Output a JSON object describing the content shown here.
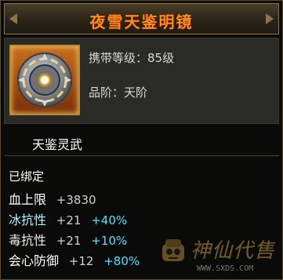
{
  "item": {
    "title": "夜雪天鉴明镜",
    "level_line": "携带等级：85级",
    "grade_line": "品阶：天阶",
    "name": "天鉴灵武",
    "bound": "已绑定",
    "icon": "mirror-icon"
  },
  "stats": [
    {
      "label": "血上限",
      "value": "+3830",
      "percent": ""
    },
    {
      "label": "冰抗性",
      "value": "+21",
      "percent": "+40%"
    },
    {
      "label": "毒抗性",
      "value": "+21",
      "percent": "+10%"
    },
    {
      "label": "会心防御",
      "value": "+12",
      "percent": "+80%"
    }
  ],
  "watermark": {
    "text": "神仙代售",
    "url": "WWW.SXDS.COM"
  },
  "colors": {
    "title": "#ff8c1a",
    "percent": "#4de0ff",
    "ice_label": "#b8f0ff"
  }
}
